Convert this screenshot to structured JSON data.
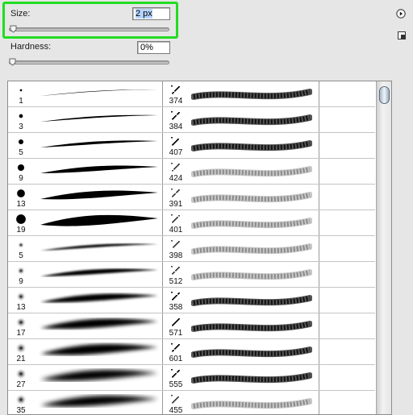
{
  "panel": {
    "size": {
      "label": "Size:",
      "value_selected": "2 px",
      "slider_fraction": 0.01
    },
    "hardness": {
      "label": "Hardness:",
      "value": "0%",
      "slider_fraction": 0.0
    }
  },
  "icons": {
    "menu": "panel-menu-icon",
    "new_preset": "new-preset-icon"
  },
  "brushes_left": [
    {
      "size": "1",
      "style": "hard"
    },
    {
      "size": "3",
      "style": "hard"
    },
    {
      "size": "5",
      "style": "hard"
    },
    {
      "size": "9",
      "style": "hard"
    },
    {
      "size": "13",
      "style": "hard"
    },
    {
      "size": "19",
      "style": "hard"
    },
    {
      "size": "5",
      "style": "soft"
    },
    {
      "size": "9",
      "style": "soft"
    },
    {
      "size": "13",
      "style": "soft"
    },
    {
      "size": "17",
      "style": "soft"
    },
    {
      "size": "21",
      "style": "soft"
    },
    {
      "size": "27",
      "style": "soft"
    },
    {
      "size": "35",
      "style": "soft"
    }
  ],
  "brushes_right": [
    {
      "size": "374",
      "style": "dark"
    },
    {
      "size": "384",
      "style": "dark"
    },
    {
      "size": "407",
      "style": "dark"
    },
    {
      "size": "424",
      "style": "light"
    },
    {
      "size": "391",
      "style": "light"
    },
    {
      "size": "401",
      "style": "light"
    },
    {
      "size": "398",
      "style": "light"
    },
    {
      "size": "512",
      "style": "light"
    },
    {
      "size": "358",
      "style": "dark"
    },
    {
      "size": "571",
      "style": "dark"
    },
    {
      "size": "601",
      "style": "dark"
    },
    {
      "size": "555",
      "style": "dark"
    },
    {
      "size": "455",
      "style": "light"
    }
  ]
}
